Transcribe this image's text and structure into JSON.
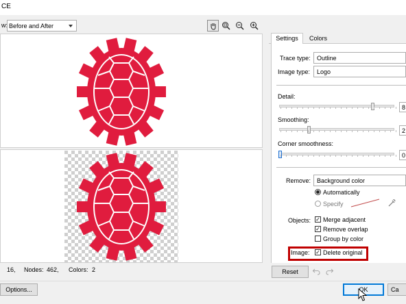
{
  "window": {
    "title": "CE"
  },
  "toolbar": {
    "preview_mode_label": "w:",
    "preview_mode_value": "Before and After",
    "tool_icons": [
      "hand-icon",
      "zoom-fit-icon",
      "zoom-out-icon",
      "zoom-in-icon"
    ]
  },
  "tabs": [
    {
      "label": "Settings",
      "active": true
    },
    {
      "label": "Colors",
      "active": false
    }
  ],
  "settings": {
    "trace_type_label": "Trace type:",
    "trace_type_value": "Outline",
    "image_type_label": "Image type:",
    "image_type_value": "Logo",
    "detail_label": "Detail:",
    "detail_value": "8",
    "smoothing_label": "Smoothing:",
    "smoothing_value": "2",
    "corner_label": "Corner smoothness:",
    "corner_value": "0",
    "remove_label": "Remove:",
    "remove_value": "Background color",
    "automatically_label": "Automatically",
    "specify_label": "Specify",
    "objects_label": "Objects:",
    "merge_adjacent_label": "Merge adjacent",
    "remove_overlap_label": "Remove overlap",
    "group_by_color_label": "Group by color",
    "image_label": "Image:",
    "delete_original_label": "Delete original",
    "checks": {
      "merge_adjacent": true,
      "remove_overlap": true,
      "group_by_color": false,
      "delete_original": true
    },
    "radio_selected": "automatically",
    "highlight_color": "#c00000",
    "specify_line_color": "#c14a4a"
  },
  "status": {
    "curves_value": "16,",
    "nodes_label": "Nodes:",
    "nodes_value": "462,",
    "colors_label": "Colors:",
    "colors_value": "2"
  },
  "buttons": {
    "reset": "Reset",
    "options": "Options...",
    "ok": "OK",
    "cancel": "Ca"
  },
  "image": {
    "turtle_color": "#e01c3e"
  }
}
